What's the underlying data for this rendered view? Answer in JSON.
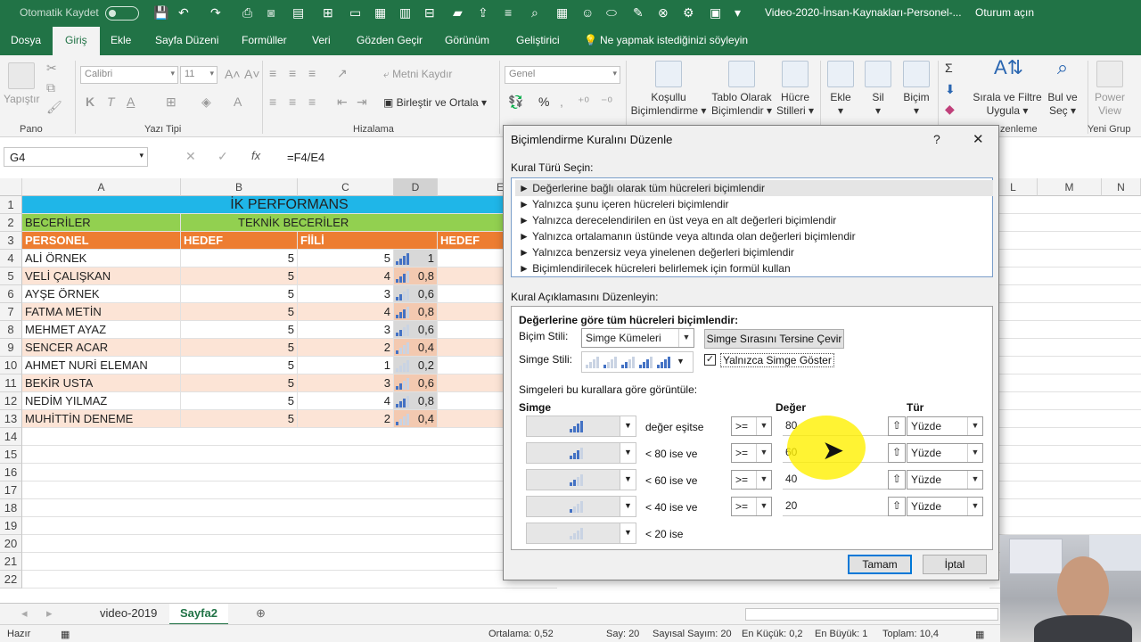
{
  "titlebar": {
    "autosave": "Otomatik Kaydet",
    "filename": "Video-2020-İnsan-Kaynakları-Personel-...",
    "signin": "Oturum açın"
  },
  "tabs": [
    "Dosya",
    "Giriş",
    "Ekle",
    "Sayfa Düzeni",
    "Formüller",
    "Veri",
    "Gözden Geçir",
    "Görünüm",
    "Geliştirici"
  ],
  "tell_me": "Ne yapmak istediğinizi söyleyin",
  "ribbon": {
    "paste": "Yapıştır",
    "pano": "Pano",
    "font_name": "Calibri",
    "font_size": "11",
    "font_group": "Yazı Tipi",
    "wrap_text": "Metni Kaydır",
    "merge_center": "Birleştir ve Ortala",
    "align_group": "Hizalama",
    "number_format": "Genel",
    "cond_format": [
      "Koşullu",
      "Biçimlendirme"
    ],
    "table_format": [
      "Tablo Olarak",
      "Biçimlendir"
    ],
    "cell_styles": [
      "Hücre",
      "Stilleri"
    ],
    "insert": "Ekle",
    "delete": "Sil",
    "format": "Biçim",
    "sort_filter": [
      "Sırala ve Filtre",
      "Uygula"
    ],
    "find_select": [
      "Bul ve",
      "Seç"
    ],
    "power_view": [
      "Power",
      "View"
    ],
    "edit_group": "zenleme",
    "new_group": "Yeni Grup"
  },
  "formula_bar": {
    "name_box": "G4",
    "fx": "fx",
    "formula": "=F4/E4"
  },
  "sheet": {
    "columns": [
      "A",
      "B",
      "C",
      "D",
      "E",
      "L",
      "M",
      "N"
    ],
    "title": "İK PERFORMANS",
    "row2": [
      "BECERİLER",
      "TEKNİK BECERİLER"
    ],
    "row3": [
      "PERSONEL",
      "HEDEF",
      "FİİLİ",
      "HEDEF"
    ],
    "rows": [
      {
        "name": "ALİ ÖRNEK",
        "b": "5",
        "c": "5",
        "d": "1",
        "level": 1.0
      },
      {
        "name": "VELİ ÇALIŞKAN",
        "b": "5",
        "c": "4",
        "d": "0,8",
        "level": 0.8
      },
      {
        "name": "AYŞE ÖRNEK",
        "b": "5",
        "c": "3",
        "d": "0,6",
        "level": 0.6
      },
      {
        "name": "FATMA METİN",
        "b": "5",
        "c": "4",
        "d": "0,8",
        "level": 0.8
      },
      {
        "name": "MEHMET AYAZ",
        "b": "5",
        "c": "3",
        "d": "0,6",
        "level": 0.6
      },
      {
        "name": "SENCER ACAR",
        "b": "5",
        "c": "2",
        "d": "0,4",
        "level": 0.4
      },
      {
        "name": "AHMET NURİ ELEMAN",
        "b": "5",
        "c": "1",
        "d": "0,2",
        "level": 0.2
      },
      {
        "name": "BEKİR USTA",
        "b": "5",
        "c": "3",
        "d": "0,6",
        "level": 0.6
      },
      {
        "name": "NEDİM YILMAZ",
        "b": "5",
        "c": "4",
        "d": "0,8",
        "level": 0.8
      },
      {
        "name": "MUHİTTİN DENEME",
        "b": "5",
        "c": "2",
        "d": "0,4",
        "level": 0.4
      }
    ],
    "row_numbers": [
      "1",
      "2",
      "3",
      "4",
      "5",
      "6",
      "7",
      "8",
      "9",
      "10",
      "11",
      "12",
      "13",
      "14",
      "15",
      "16",
      "17",
      "18",
      "19",
      "20",
      "21",
      "22"
    ]
  },
  "sheet_tabs": [
    "video-2019",
    "Sayfa2"
  ],
  "status": {
    "ready": "Hazır",
    "average": "Ortalama: 0,52",
    "count": "Say: 20",
    "numeric_count": "Sayısal Sayım: 20",
    "min": "En Küçük: 0,2",
    "max": "En Büyük: 1",
    "sum": "Toplam: 10,4"
  },
  "dialog": {
    "title": "Biçimlendirme Kuralını Düzenle",
    "help": "?",
    "close": "✕",
    "rule_type_label": "Kural Türü Seçin:",
    "rule_types": [
      "► Değerlerine bağlı olarak tüm hücreleri biçimlendir",
      "► Yalnızca şunu içeren hücreleri biçimlendir",
      "► Yalnızca derecelendirilen en üst veya en alt değerleri biçimlendir",
      "► Yalnızca ortalamanın üstünde veya altında olan değerleri biçimlendir",
      "► Yalnızca benzersiz veya yinelenen değerleri biçimlendir",
      "► Biçimlendirilecek hücreleri belirlemek için formül kullan"
    ],
    "desc_label": "Kural Açıklamasını Düzenleyin:",
    "desc_heading": "Değerlerine göre tüm hücreleri biçimlendir:",
    "format_style_label": "Biçim Stili:",
    "format_style_value": "Simge Kümeleri",
    "reverse_button": "Simge Sırasını Tersine Çevir",
    "icon_style_label": "Simge Stili:",
    "show_icon_only": "Yalnızca Simge Göster",
    "rules_caption": "Simgeleri bu kurallara göre görüntüle:",
    "col_icon": "Simge",
    "col_value": "Değer",
    "col_type": "Tür",
    "icon_rules": [
      {
        "text": "değer eşitse",
        "op": ">=",
        "value": "80",
        "type": "Yüzde",
        "level": 4
      },
      {
        "text": "< 80 ise ve",
        "op": ">=",
        "value": "60",
        "type": "Yüzde",
        "level": 3
      },
      {
        "text": "< 60 ise ve",
        "op": ">=",
        "value": "40",
        "type": "Yüzde",
        "level": 2
      },
      {
        "text": "< 40 ise ve",
        "op": ">=",
        "value": "20",
        "type": "Yüzde",
        "level": 1
      },
      {
        "text": "< 20 ise",
        "level": 0
      }
    ],
    "ok": "Tamam",
    "cancel": "İptal"
  },
  "colors": {
    "excel_green": "#217346",
    "title_cyan": "#1fb6e8",
    "header_green": "#92d050",
    "header_orange": "#ed7d31",
    "row_pink": "#fce4d6",
    "icon_blue": "#4472c4"
  }
}
